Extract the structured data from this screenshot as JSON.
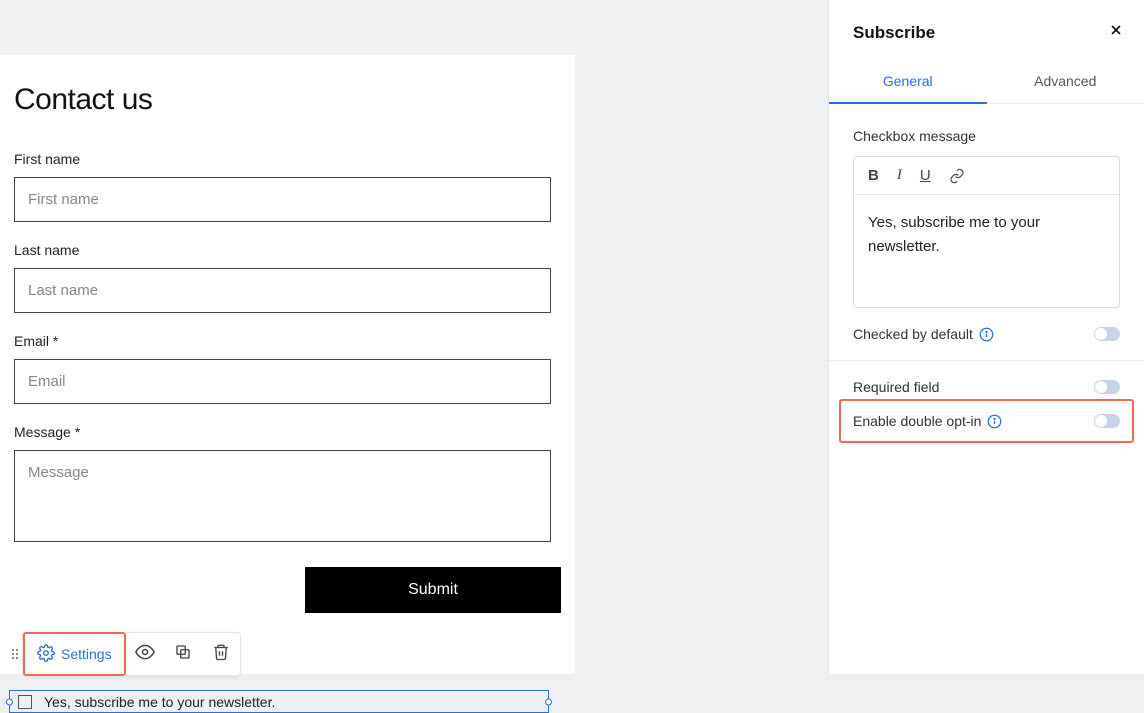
{
  "form": {
    "title": "Contact us",
    "fields": {
      "first_name": {
        "label": "First name",
        "placeholder": "First name"
      },
      "last_name": {
        "label": "Last name",
        "placeholder": "Last name"
      },
      "email": {
        "label": "Email *",
        "placeholder": "Email"
      },
      "message": {
        "label": "Message *",
        "placeholder": "Message"
      }
    },
    "submit_label": "Submit",
    "subscribe_checkbox_text": "Yes, subscribe me to your newsletter."
  },
  "toolbar": {
    "settings_label": "Settings"
  },
  "panel": {
    "title": "Subscribe",
    "tabs": {
      "general": "General",
      "advanced": "Advanced"
    },
    "checkbox_message_label": "Checkbox message",
    "rte_text": "Yes, subscribe me to your newsletter.",
    "options": {
      "checked_default": "Checked by default",
      "required_field": "Required field",
      "double_optin": "Enable double opt-in"
    }
  }
}
